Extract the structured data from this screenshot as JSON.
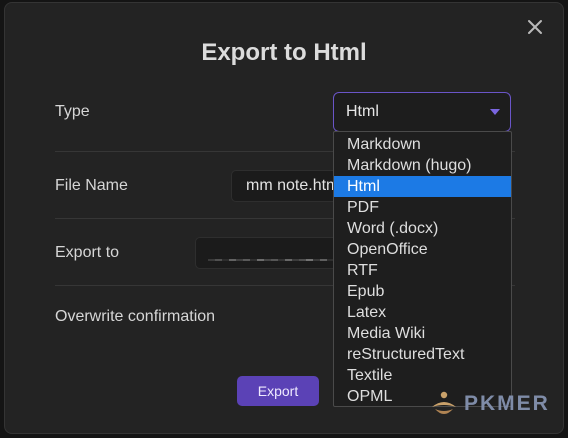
{
  "dialog": {
    "title": "Export to Html",
    "close_label": "×"
  },
  "rows": {
    "type_label": "Type",
    "file_name_label": "File Name",
    "export_to_label": "Export to",
    "overwrite_label": "Overwrite confirmation"
  },
  "type_select": {
    "value": "Html"
  },
  "file_name": {
    "value": "mm note.html"
  },
  "dropdown": {
    "options": [
      "Markdown",
      "Markdown (hugo)",
      "Html",
      "PDF",
      "Word (.docx)",
      "OpenOffice",
      "RTF",
      "Epub",
      "Latex",
      "Media Wiki",
      "reStructuredText",
      "Textile",
      "OPML"
    ],
    "selected_index": 2
  },
  "export_button": {
    "label": "Export"
  },
  "watermark": {
    "text": "PKMER"
  },
  "colors": {
    "accent": "#5b42b6",
    "select_border": "#6a55c8",
    "selected_item": "#1c7ae5"
  }
}
